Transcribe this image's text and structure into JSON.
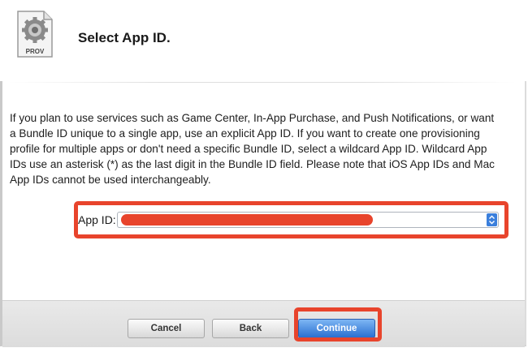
{
  "header": {
    "title": "Select App ID.",
    "icon": {
      "name": "provisioning-profile-icon",
      "label": "PROV"
    }
  },
  "description": "If you plan to use services such as Game Center, In-App Purchase, and Push Notifications, or want a Bundle ID unique to a single app, use an explicit App ID. If you want to create one provisioning profile for multiple apps or don't need a specific Bundle ID, select a wildcard App ID. Wildcard App IDs use an asterisk (*) as the last digit in the Bundle ID field. Please note that iOS App IDs and Mac App IDs cannot be used interchangeably.",
  "app_id": {
    "label": "App ID:",
    "selected_value": "",
    "redacted": true
  },
  "buttons": {
    "cancel": "Cancel",
    "back": "Back",
    "continue": "Continue"
  },
  "colors": {
    "annotation": "#e8442c",
    "primary_button": "#2a6fd0"
  }
}
